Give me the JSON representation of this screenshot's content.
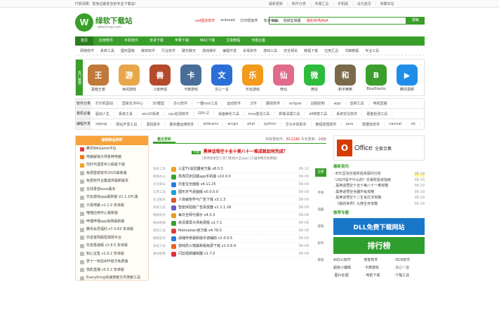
{
  "topbar": {
    "tip": "IT资讯网：您身边最安全的专业下载站！",
    "links": [
      "最新更新",
      "软件分类",
      "专题汇总",
      "手机版",
      "设为首页",
      "收藏本站"
    ]
  },
  "logo": {
    "mark": "W",
    "name": "绿软下载站",
    "url": "www.lrnzp.com"
  },
  "search": {
    "value": "wps",
    "button": "搜索"
  },
  "hotwords": [
    {
      "text": "ssd固态软件",
      "hot": true
    },
    {
      "text": "autocad",
      "hot": false
    },
    {
      "text": "打印机软件",
      "hot": false
    },
    {
      "text": "安卓字体",
      "hot": false
    },
    {
      "text": "视频剪辑器",
      "hot": false
    },
    {
      "text": "我的世界JAVA",
      "hot": true
    }
  ],
  "nav": [
    "首页",
    "应用软件",
    "手机软件",
    "安卓下载",
    "苹果下载",
    "MAC下载",
    "文章教程",
    "专题合集"
  ],
  "nav_right": "排行榜",
  "subnav": [
    "网络软件",
    "系统工具",
    "图形图像",
    "媒体软件",
    "行业软件",
    "聊天聊天",
    "游戏娱乐",
    "编程开发",
    "杀毒软件",
    "游戏工具",
    "安全相关",
    "教程下载",
    "应用汇总",
    "书籍教程",
    "专业工具"
  ],
  "apps_label": "热门推荐",
  "apps": [
    {
      "name": "黑暗王者",
      "color": "#c0793a",
      "glyph": "王"
    },
    {
      "name": "休闲游戏",
      "color": "#e8a64a",
      "glyph": "游"
    },
    {
      "name": "斗兽养成",
      "color": "#b34a2b",
      "glyph": "兽"
    },
    {
      "name": "卡牌游戏",
      "color": "#4a6e9a",
      "glyph": "卡"
    },
    {
      "name": "文心一言",
      "color": "#2a6fd6",
      "glyph": "文"
    },
    {
      "name": "乐玩游戏",
      "color": "#f29a1c",
      "glyph": "乐"
    },
    {
      "name": "奇仙",
      "color": "#e06b8a",
      "glyph": "仙"
    },
    {
      "name": "微信",
      "color": "#2dbb3c",
      "glyph": "微"
    },
    {
      "name": "和平精英",
      "color": "#7a6a4a",
      "glyph": "和"
    },
    {
      "name": "BlueStacks",
      "color": "#3ba02b",
      "glyph": "B"
    },
    {
      "name": "腾讯视频",
      "color": "#1e8ee9",
      "glyph": "▶"
    }
  ],
  "tagrows": [
    {
      "head": "软件分类",
      "tags": [
        "打印机驱动",
        "国家反诈中心",
        "3D模型",
        "办公软件",
        "一键root工具",
        "运动软件",
        "汉字",
        "翻译软件",
        "eclipse",
        "远程控制",
        "wps",
        "音频工具",
        "电视直播"
      ]
    },
    {
      "head": "装机必备",
      "tags": [
        "驱动人生",
        "系统工具",
        "win10系统",
        "cpu检测软件",
        "GPU-Z",
        "桌面美化工具",
        "kms激活工具",
        "卸载清理工具",
        "dll修复工具",
        "系统优化软件",
        "硬盘检测工具"
      ]
    },
    {
      "head": "编程开发",
      "tags": [
        "sqlyog",
        "网站开发工具",
        "源码助手",
        "服务器运维软件",
        "jetbrains",
        "arcgis",
        "phpl",
        "python",
        "华为手机助手",
        "教程管理软件",
        "java",
        "数据库软件",
        "navicat",
        "vb"
      ]
    }
  ],
  "left": {
    "title": "编辑精品推荐",
    "items": [
      "腾讯WeGame平台",
      "电脑解锁大师各种电脑",
      "优时代理发布小蚂蚁下载",
      "免费壁纸软件2025最新版",
      "免费软件合集提供最新版本",
      "在线录音boss版本",
      "乐玩游戏app最新版 V1.1.1PC版",
      "只需电脑 v1.1.0 安卓版",
      "喵喵应用中心最新版",
      "哔哩哔哩app官网最新版",
      "腾讯会员福利 v7.0.63 安卓版",
      "抖音官网版短视频平台",
      "抖音极速版 v1.8.5 安卓版",
      "知心宝盒 v1.0.2 安卓版",
      "梦十一快剪APP官方免费版",
      "悦影直播 v3.5.2 安卓版",
      "Everything快速搜索文件搜索工具"
    ]
  },
  "mid": {
    "tabs": [
      "最近更新"
    ],
    "stats": {
      "label1": "共收录软件：",
      "total": "812248",
      "label2": "今天更新：",
      "today": "24",
      "label3": "篇"
    },
    "headline": {
      "badge": "专题",
      "text": "黑神话悟空十全十美八十一难成就如何完成？"
    },
    "sub": "[黑神话悟空] [热门影视大全app] [三国杀网页免费版]",
    "rows": [
      {
        "cat": "系统工具",
        "name": "三星TV遥控器官方版 v8.0.3",
        "date": "08-12",
        "color": "#f0a020"
      },
      {
        "cat": "网络办公",
        "name": "亮亮同步回拨app手机版 v10.0.0",
        "date": "08-09",
        "color": "#3a9e2b"
      },
      {
        "cat": "社交聊天",
        "name": "托金宝全面版 v4.11.25",
        "date": "08-09",
        "color": "#2a7be0"
      },
      {
        "cat": "实用工具",
        "name": "图形天气桌面版 v0.0.0.0",
        "date": "08-09",
        "color": "#1aa0d8"
      },
      {
        "cat": "生活服务",
        "name": "人体解剖学与广告下载 v3.1.3",
        "date": "08-09",
        "color": "#e05a2a"
      },
      {
        "cat": "系统工具",
        "name": "智能体验版广告投放器 v1.1.1.18",
        "date": "08-09",
        "color": "#6a5ac8"
      },
      {
        "cat": "网络软件",
        "name": "每日全网与报价 v4.3.3",
        "date": "08-09",
        "color": "#e8a020"
      },
      {
        "cat": "媒体图像",
        "name": "高清录屏大师免费版 v2.7.1",
        "date": "08-09",
        "color": "#3a9e2b"
      },
      {
        "cat": "游戏工具",
        "name": "Motivation官方版 v4.78.0",
        "date": "08-09",
        "color": "#d84040"
      },
      {
        "cat": "网络软件",
        "name": "战魂传奇最新版手游辅助 v1.0.0.5",
        "date": "08-09",
        "color": "#2a7be0"
      },
      {
        "cat": "系统工具",
        "name": "游戏防火墙最新版免费下载 v1.5.6.9",
        "date": "08-09",
        "color": "#f06020"
      },
      {
        "cat": "媒体图像",
        "name": "闪剪视频编辑器 v1.7.0",
        "date": "08-09",
        "color": "#e0303a"
      }
    ],
    "side": [
      "全部",
      "手机",
      "电脑",
      "游戏",
      "软件",
      "教程"
    ]
  },
  "right": {
    "office": {
      "mark": "O",
      "title": "Office",
      "sub": "全套合集"
    },
    "news_title": "最新资讯",
    "news": [
      {
        "text": "BTC区块交易所投资顾问分析",
        "date": "08-19"
      },
      {
        "text": "USDT是干什么的？交易所投资指南",
        "date": "08-19"
      },
      {
        "text": "黑神话悟空十全十美八十一难攻略",
        "date": "08-19"
      },
      {
        "text": "黑神话悟空兵器升级攻略",
        "date": "08-19"
      },
      {
        "text": "黑神话悟空十二生肖打法攻略",
        "date": "08-19"
      },
      {
        "text": "《我的世界》九族生存攻略",
        "date": "08-19"
      }
    ],
    "topic_title": "推荐专题",
    "banner1": "DLL免费下载网站",
    "banner2": "排行榜",
    "tools": [
      "AI办公软件",
      "修复软件",
      "·OCR软件",
      "超级小编辑",
      "·卡牌游戏",
      "·文心一言",
      "·图片处理",
      "··电影下载",
      "·下载工具"
    ]
  }
}
